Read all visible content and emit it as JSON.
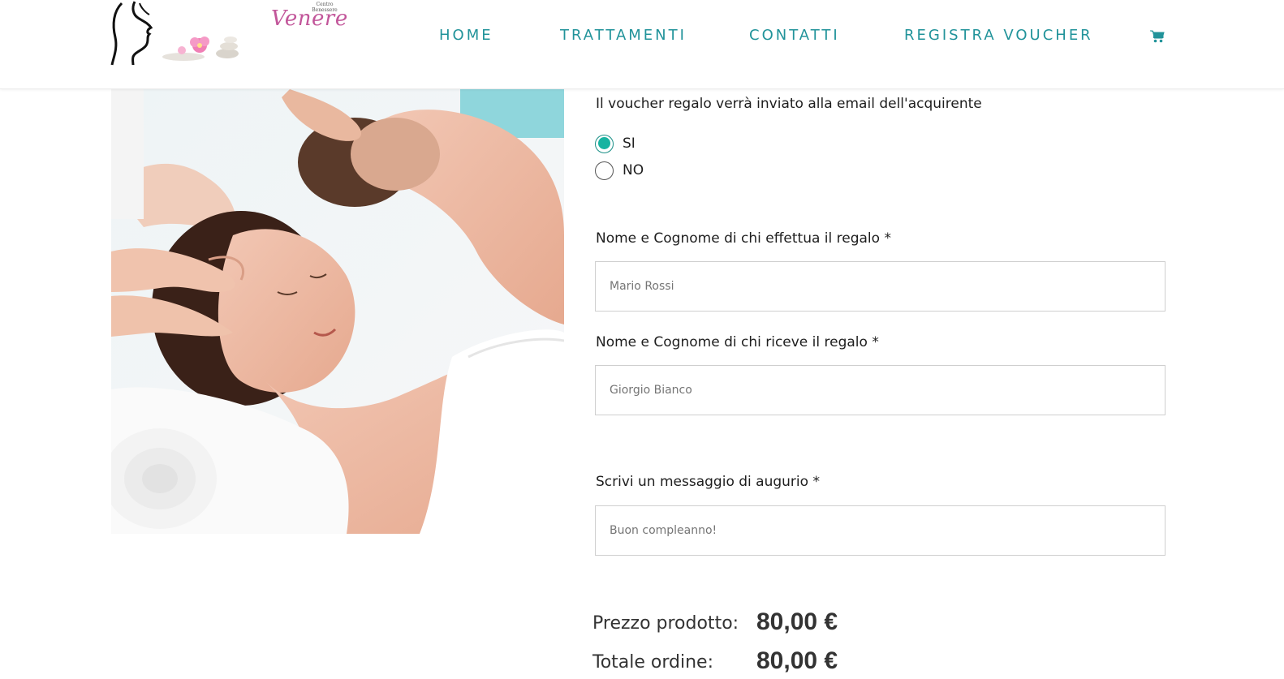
{
  "header": {
    "logo": {
      "brand": "Venere",
      "small_line1": "Centro",
      "small_line2": "Benessere"
    },
    "nav": [
      {
        "label": "HOME"
      },
      {
        "label": "TRATTAMENTI"
      },
      {
        "label": "CONTATTI"
      },
      {
        "label": "REGISTRA VOUCHER"
      }
    ],
    "cart_icon": "shopping-cart-icon",
    "accent_color": "#21939a"
  },
  "form": {
    "email_question": "Il voucher regalo verrà inviato alla email dell'acquirente",
    "options": [
      {
        "label": "SI",
        "checked": true
      },
      {
        "label": "NO",
        "checked": false
      }
    ],
    "giver_label": "Nome e Cognome di chi effettua il regalo *",
    "giver_placeholder": "Mario Rossi",
    "receiver_label": "Nome e Cognome di chi riceve il regalo *",
    "receiver_placeholder": "Giorgio Bianco",
    "message_label": "Scrivi un messaggio di augurio *",
    "message_placeholder": "Buon compleanno!",
    "radio_color": "#18b3a1"
  },
  "summary": {
    "product_price_label": "Prezzo prodotto:",
    "product_price": "80,00 €",
    "order_total_label": "Totale ordine:",
    "order_total": "80,00 €"
  }
}
